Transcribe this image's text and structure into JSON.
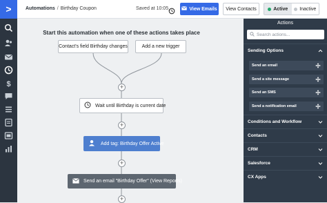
{
  "nav": {
    "logo": ">",
    "items": [
      "search-icon",
      "contacts-icon",
      "campaigns-icon",
      "automations-icon",
      "deals-icon",
      "conversations-icon",
      "lists-icon",
      "reports-icon",
      "pages-icon",
      "analytics-icon"
    ]
  },
  "header": {
    "breadcrumb_root": "Automations",
    "breadcrumb_sep": "/",
    "breadcrumb_current": "Birthday Coupon",
    "saved_text": "Saved at 10:05",
    "view_emails_label": "View Emails",
    "view_contacts_label": "View Contacts",
    "active_label": "Active",
    "inactive_label": "Inactive"
  },
  "canvas": {
    "start_title": "Start this automation when one of these actions takes place",
    "triggers": [
      "Contact's field Birthday changes",
      "Add a new trigger"
    ],
    "wait_step": "Wait until Birthday is current date",
    "tag_step": "Add tag: Birthday Offer Active",
    "email_step": "Send an email \"Birthday Offer\" (View Reports)",
    "plus_symbol": "+"
  },
  "panel": {
    "title": "Actions",
    "search_placeholder": "Search actions...",
    "sending_options_label": "Sending Options",
    "sending_items": [
      "Send an email",
      "Send a site message",
      "Send an SMS",
      "Send a notification email"
    ],
    "sections": [
      "Conditions and Workflow",
      "Contacts",
      "CRM",
      "Salesforce",
      "CX Apps"
    ]
  },
  "colors": {
    "accent": "#356ae6",
    "nav_bg": "#2c3540",
    "panel_bg": "#2f3b49",
    "tag_step": "#4e7fcf",
    "email_step": "#5d6670",
    "active_dot": "#23a86b"
  }
}
